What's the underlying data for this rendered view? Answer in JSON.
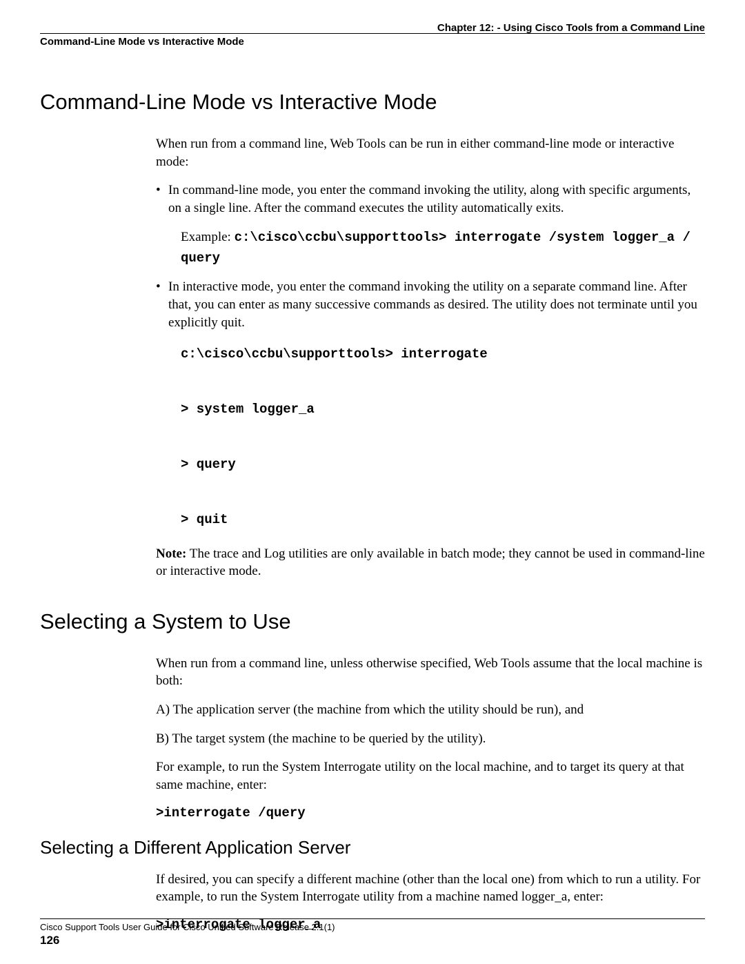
{
  "header": {
    "chapter": "Chapter 12: - Using Cisco Tools from a Command Line",
    "section": "Command-Line Mode vs Interactive Mode"
  },
  "s1": {
    "title": "Command-Line Mode vs Interactive Mode",
    "intro": "When run from a command line, Web Tools can be run in either command-line mode or interactive mode:",
    "b1": "In command-line mode, you enter the command invoking the utility, along with specific arguments, on a single line. After the command executes the utility automatically exits.",
    "ex_label": "Example: ",
    "ex_code": "c:\\cisco\\ccbu\\supporttools> interrogate /system logger_a / query",
    "b2": "In interactive mode, you enter the command invoking the utility on a separate command line. After that, you can enter as many successive commands as desired. The utility does not terminate until you explicitly quit.",
    "cb": "c:\\cisco\\ccbu\\supporttools> interrogate\n\n> system logger_a\n\n> query\n\n> quit",
    "note_label": "Note:",
    "note": " The trace and Log utilities are only available in batch mode; they cannot be used in command-line or interactive mode."
  },
  "s2": {
    "title": "Selecting a System to Use",
    "p1": "When run from a command line, unless otherwise specified, Web Tools assume that the local machine is both:",
    "p2": "A) The application server (the machine from which the utility should be run), and",
    "p3": "B) The target system (the machine to be queried by the utility).",
    "p4": "For example, to run the System Interrogate utility on the local machine, and to target its query at that same machine, enter:",
    "code": ">interrogate /query"
  },
  "s3": {
    "title": "Selecting a Different Application Server",
    "p1": "If desired, you can specify a different machine (other than the local one) from which to run a utility. For example, to run the System Interrogate utility from a machine named logger_a, enter:",
    "code": ">interrogate logger_a"
  },
  "footer": {
    "text": "Cisco Support Tools User Guide for Cisco Unified Software Release 2.1(1)",
    "page": "126"
  }
}
